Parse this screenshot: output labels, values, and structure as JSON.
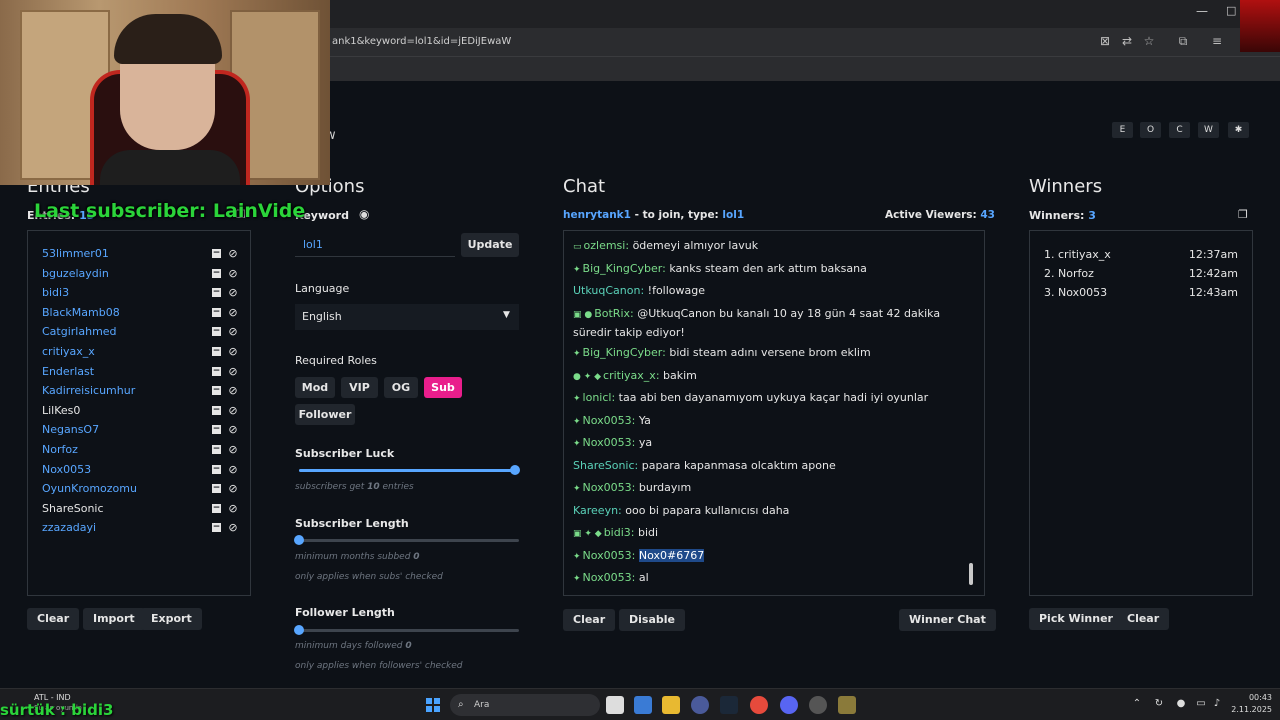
{
  "browser": {
    "url": "ank1&keyword=lol1&id=jEDiJEwaW",
    "min_glyph": "—",
    "max_glyph": "□"
  },
  "app": {
    "title_fragment": "w",
    "theme_buttons": [
      "E",
      "O",
      "C",
      "W",
      "✱"
    ]
  },
  "entries": {
    "title": "Entries",
    "count_label": "Entries:",
    "count": "15",
    "names": [
      {
        "name": "53limmer01",
        "color": "blue"
      },
      {
        "name": "bguzelaydin",
        "color": "blue"
      },
      {
        "name": "bidi3",
        "color": "blue"
      },
      {
        "name": "BlackMamb08",
        "color": "blue"
      },
      {
        "name": "Catgirlahmed",
        "color": "blue"
      },
      {
        "name": "critiyax_x",
        "color": "blue"
      },
      {
        "name": "Enderlast",
        "color": "blue"
      },
      {
        "name": "Kadirreisicumhur",
        "color": "blue"
      },
      {
        "name": "LilKes0",
        "color": "white"
      },
      {
        "name": "NegansO7",
        "color": "blue"
      },
      {
        "name": "Norfoz",
        "color": "blue"
      },
      {
        "name": "Nox0053",
        "color": "blue"
      },
      {
        "name": "OyunKromozomu",
        "color": "blue"
      },
      {
        "name": "ShareSonic",
        "color": "white"
      },
      {
        "name": "zzazadayi",
        "color": "blue"
      }
    ],
    "buttons": {
      "clear": "Clear",
      "import": "Import",
      "export": "Export"
    }
  },
  "options": {
    "title": "Options",
    "keyword_label": "Keyword",
    "keyword_value": "lol1",
    "update": "Update",
    "language_label": "Language",
    "language_value": "English",
    "roles_label": "Required Roles",
    "roles": [
      {
        "label": "Mod",
        "active": false
      },
      {
        "label": "VIP",
        "active": false
      },
      {
        "label": "OG",
        "active": false
      },
      {
        "label": "Sub",
        "active": true
      },
      {
        "label": "Follower",
        "active": false
      }
    ],
    "sub_luck_label": "Subscriber Luck",
    "sub_luck_level": 1.0,
    "sub_luck_hint_pre": "subscribers get",
    "sub_luck_hint_num": "10",
    "sub_luck_hint_post": "entries",
    "sub_length_label": "Subscriber Length",
    "sub_length_level": 0,
    "sub_length_hint_pre": "minimum months subbed",
    "sub_length_hint_num": "0",
    "sub_length_hint2": "only applies when subs' checked",
    "follow_length_label": "Follower Length",
    "follow_length_level": 0,
    "follow_length_hint_pre": "minimum days followed",
    "follow_length_hint_num": "0",
    "follow_length_hint2": "only applies when followers' checked"
  },
  "chat": {
    "title": "Chat",
    "channel": "henrytank1",
    "join_text": "- to join, type:",
    "join_keyword": "lol1",
    "viewers_label": "Active Viewers:",
    "viewers": "43",
    "messages": [
      {
        "badge": "▭",
        "user": "ozlemsi:",
        "text": "ödemeyi almıyor lavuk"
      },
      {
        "badge": "✦",
        "user": "Big_KingCyber:",
        "text": "kanks steam den ark attım baksana"
      },
      {
        "badge": "",
        "user": "UtkuqCanon:",
        "text": "!followage"
      },
      {
        "badge": "▣ ●",
        "user": "BotRix:",
        "text": "@UtkuqCanon bu kanalı 10 ay 18 gün 4 saat 42 dakika",
        "text2": "süredir takip ediyor!"
      },
      {
        "badge": "✦",
        "user": "Big_KingCyber:",
        "text": "bidi steam adını versene brom eklim"
      },
      {
        "badge": "● ✦ ◆",
        "user": "critiyax_x:",
        "text": "bakim"
      },
      {
        "badge": "✦",
        "user": "lonicl:",
        "text": "taa abi ben dayanamıyom uykuya kaçar hadi iyi oyunlar"
      },
      {
        "badge": "✦",
        "user": "Nox0053:",
        "text": "Ya"
      },
      {
        "badge": "✦",
        "user": "Nox0053:",
        "text": "ya"
      },
      {
        "badge": "",
        "user": "ShareSonic:",
        "text": "papara kapanmasa olcaktım apone"
      },
      {
        "badge": "✦",
        "user": "Nox0053:",
        "text": "burdayım"
      },
      {
        "badge": "",
        "user": "Kareeyn:",
        "text": "ooo bi papara kullanıcısı daha"
      },
      {
        "badge": "▣ ✦ ◆",
        "user": "bidi3:",
        "text": "bidi"
      },
      {
        "badge": "✦",
        "user": "Nox0053:",
        "text": "Nox0#6767",
        "selected": true
      },
      {
        "badge": "✦",
        "user": "Nox0053:",
        "text": "al"
      }
    ],
    "buttons": {
      "clear": "Clear",
      "disable": "Disable",
      "winner_chat": "Winner Chat"
    }
  },
  "winners": {
    "title": "Winners",
    "count_label": "Winners:",
    "count": "3",
    "list": [
      {
        "rank": "1.",
        "name": "critiyax_x",
        "time": "12:37am"
      },
      {
        "rank": "2.",
        "name": "Norfoz",
        "time": "12:42am"
      },
      {
        "rank": "3.",
        "name": "Nox0053",
        "time": "12:43am"
      }
    ],
    "buttons": {
      "pick": "Pick Winner",
      "clear": "Clear"
    }
  },
  "overlay": {
    "last_subscriber": "Last subscriber: LainVide",
    "bottom_text": "sürtük : bidi3"
  },
  "taskbar": {
    "weather_line1": "ATL - IND",
    "weather_line2": "Şu an oyunda",
    "search_placeholder": "Ara",
    "time": "00:43",
    "date": "2.11.2025"
  },
  "colors": {
    "accent": "#58a6ff",
    "sub_active": "#e91e8c",
    "overlay_green": "#2bd43a"
  }
}
